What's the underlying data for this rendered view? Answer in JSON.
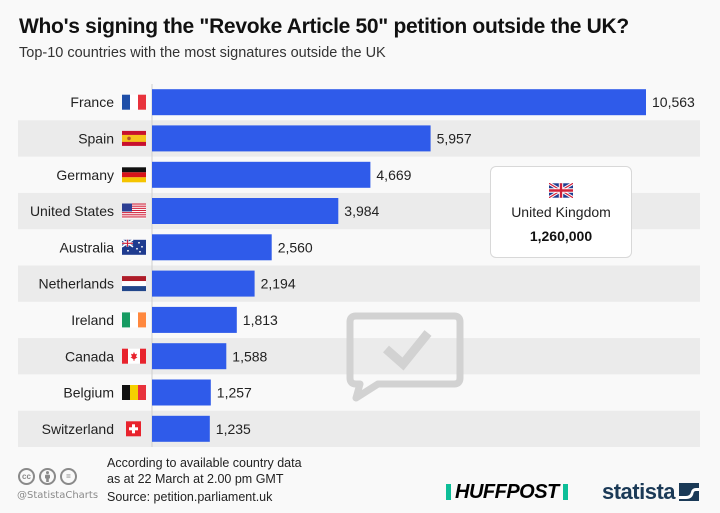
{
  "header": {
    "title": "Who's signing the \"Revoke Article 50\" petition outside the UK?",
    "subtitle": "Top-10 countries with the most signatures outside the UK"
  },
  "chart_data": {
    "type": "bar",
    "orientation": "horizontal",
    "title": "Who's signing the \"Revoke Article 50\" petition outside the UK?",
    "subtitle": "Top-10 countries with the most signatures outside the UK",
    "categories": [
      "France",
      "Spain",
      "Germany",
      "United States",
      "Australia",
      "Netherlands",
      "Ireland",
      "Canada",
      "Belgium",
      "Switzerland"
    ],
    "values": [
      10563,
      5957,
      4669,
      3984,
      2560,
      2194,
      1813,
      1588,
      1257,
      1235
    ],
    "value_labels": [
      "10,563",
      "5,957",
      "4,669",
      "3,984",
      "2,560",
      "2,194",
      "1,813",
      "1,588",
      "1,257",
      "1,235"
    ],
    "flags": [
      "france-flag",
      "spain-flag",
      "germany-flag",
      "usa-flag",
      "australia-flag",
      "netherlands-flag",
      "ireland-flag",
      "canada-flag",
      "belgium-flag",
      "switzerland-flag"
    ],
    "xlabel": "",
    "ylabel": "",
    "xlim": [
      0,
      10563
    ],
    "grid": false,
    "bar_color": "#2f5bea",
    "stripe_color": "#ebebeb",
    "annotation": {
      "label": "United Kingdom",
      "value": 1260000,
      "value_label": "1,260,000",
      "flag": "uk-flag"
    }
  },
  "callout": {
    "name": "United Kingdom",
    "value": "1,260,000"
  },
  "footer": {
    "note_line1": "According to available country data",
    "note_line2": "as at 22 March at 2.00 pm GMT",
    "source": "Source: petition.parliament.uk",
    "handle": "@StatistaCharts",
    "cc_icons": [
      "cc",
      "by",
      "nd"
    ],
    "cc_labels": [
      "cc",
      "",
      "="
    ],
    "brand_huffpost": "HUFFPOST",
    "brand_statista": "statista"
  },
  "colors": {
    "bar": "#2f5bea",
    "huffpost_accent": "#0dbe98",
    "statista_navy": "#1b3a57"
  }
}
